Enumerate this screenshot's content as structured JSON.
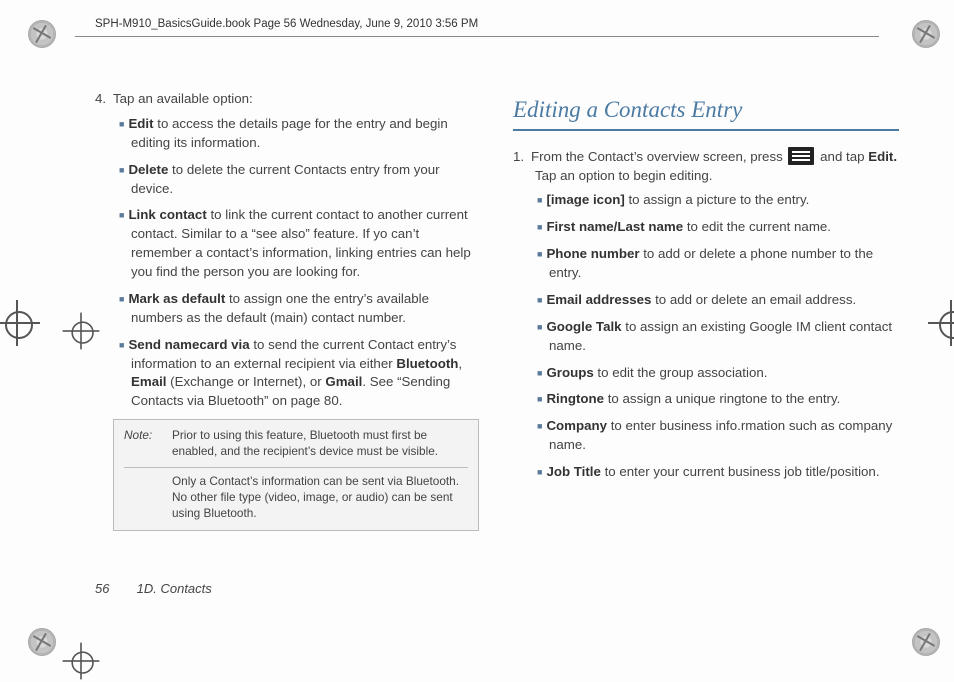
{
  "bookline": "SPH-M910_BasicsGuide.book  Page 56  Wednesday, June 9, 2010  3:56 PM",
  "left": {
    "step4": "Tap an available option:",
    "items": [
      {
        "term": "Edit",
        "rest": " to access the details page for the entry and begin editing its information."
      },
      {
        "term": "Delete",
        "rest": " to delete the current Contacts entry from your device."
      },
      {
        "term": "Link contact",
        "rest": " to link the current contact to another current contact. Similar to a “see also” feature. If yo can’t remember a contact’s information, linking entries can help you find the person you are looking for."
      },
      {
        "term": "Mark as default",
        "rest": " to assign one the entry’s available numbers as the default (main) contact number."
      },
      {
        "term": "Send namecard via",
        "rest": " to send the current Contact entry’s information to an external recipient via either ",
        "mid_terms": [
          "Bluetooth",
          "Email",
          "Gmail"
        ],
        "mid_join1": ", ",
        "mid_paren": " (Exchange or Internet), or ",
        "tail": ". See “Sending Contacts via Bluetooth” on page 80."
      }
    ],
    "note_label": "Note:",
    "note_p1": "Prior to using this feature, Bluetooth must first be enabled, and the recipient’s device must be visible.",
    "note_p2": "Only a Contact’s information can be sent via Bluetooth. No other file type (video, image, or audio) can be sent using Bluetooth."
  },
  "right": {
    "heading": "Editing a Contacts Entry",
    "step1a": "From the Contact’s overview screen, press ",
    "step1b": " and tap ",
    "step1_edit": "Edit.",
    "step1c": " Tap an option to begin editing.",
    "items": [
      {
        "term": "[image icon]",
        "rest": " to assign a picture to the entry."
      },
      {
        "term": "First name/Last name",
        "rest": " to edit the current name."
      },
      {
        "term": "Phone number",
        "rest": " to add or delete a phone number to the entry."
      },
      {
        "term": "Email addresses",
        "rest": " to add or delete an email address."
      },
      {
        "term": "Google Talk",
        "rest": " to assign an existing Google IM client contact name."
      },
      {
        "term": "Groups",
        "rest": " to edit the group association."
      },
      {
        "term": "Ringtone",
        "rest": " to assign a unique ringtone to the entry."
      },
      {
        "term": "Company",
        "rest": " to enter business info.rmation such as company name."
      },
      {
        "term": "Job Title",
        "rest": " to enter your current business job title/position."
      }
    ]
  },
  "footer": {
    "page": "56",
    "section": "1D. Contacts"
  }
}
